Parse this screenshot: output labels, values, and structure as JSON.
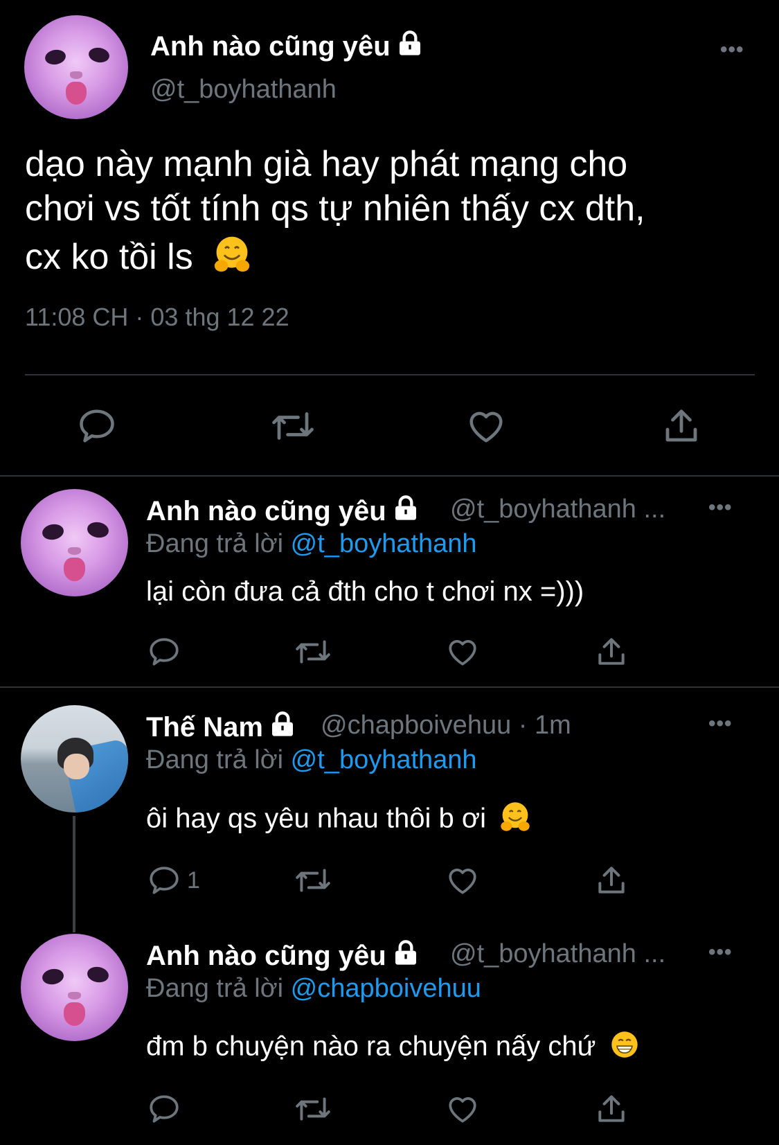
{
  "main_tweet": {
    "name": "Anh nào cũng yêu",
    "handle": "@t_boyhathanh",
    "text_line1": "dạo này mạnh già hay phát mạng cho",
    "text_line2": "chơi vs tốt tính qs tự nhiên thấy cx dth,",
    "text_line3": "cx ko tồi ls",
    "timestamp": "11:08 CH · 03 thg 12 22",
    "more_label": "•••"
  },
  "replies": [
    {
      "name": "Anh nào cũng yêu",
      "handle": "@t_boyhathanh ...",
      "replying_prefix": "Đang trả lời",
      "replying_to": "@t_boyhathanh",
      "text": "lại còn đưa cả đth cho t chơi nx =)))",
      "reply_count": "",
      "more_label": "•••"
    },
    {
      "name": "Thế Nam",
      "handle": "@chapboivehuu · 1m",
      "replying_prefix": "Đang trả lời",
      "replying_to": "@t_boyhathanh",
      "text": "ôi hay qs yêu nhau thôi b ơi",
      "reply_count": "1",
      "more_label": "•••"
    },
    {
      "name": "Anh nào cũng yêu",
      "handle": "@t_boyhathanh ...",
      "replying_prefix": "Đang trả lời",
      "replying_to": "@chapboivehuu",
      "text": "đm b chuyện nào ra chuyện nấy chứ",
      "reply_count": "",
      "more_label": "•••"
    }
  ],
  "colors": {
    "background": "#000000",
    "text": "#ffffff",
    "muted": "#6e767d",
    "mention": "#1d9bf0",
    "divider": "#2f3336"
  },
  "icons": [
    "lock-icon",
    "more-icon",
    "reply-icon",
    "retweet-icon",
    "like-icon",
    "share-icon",
    "hugging-face-emoji",
    "grinning-face-emoji"
  ]
}
